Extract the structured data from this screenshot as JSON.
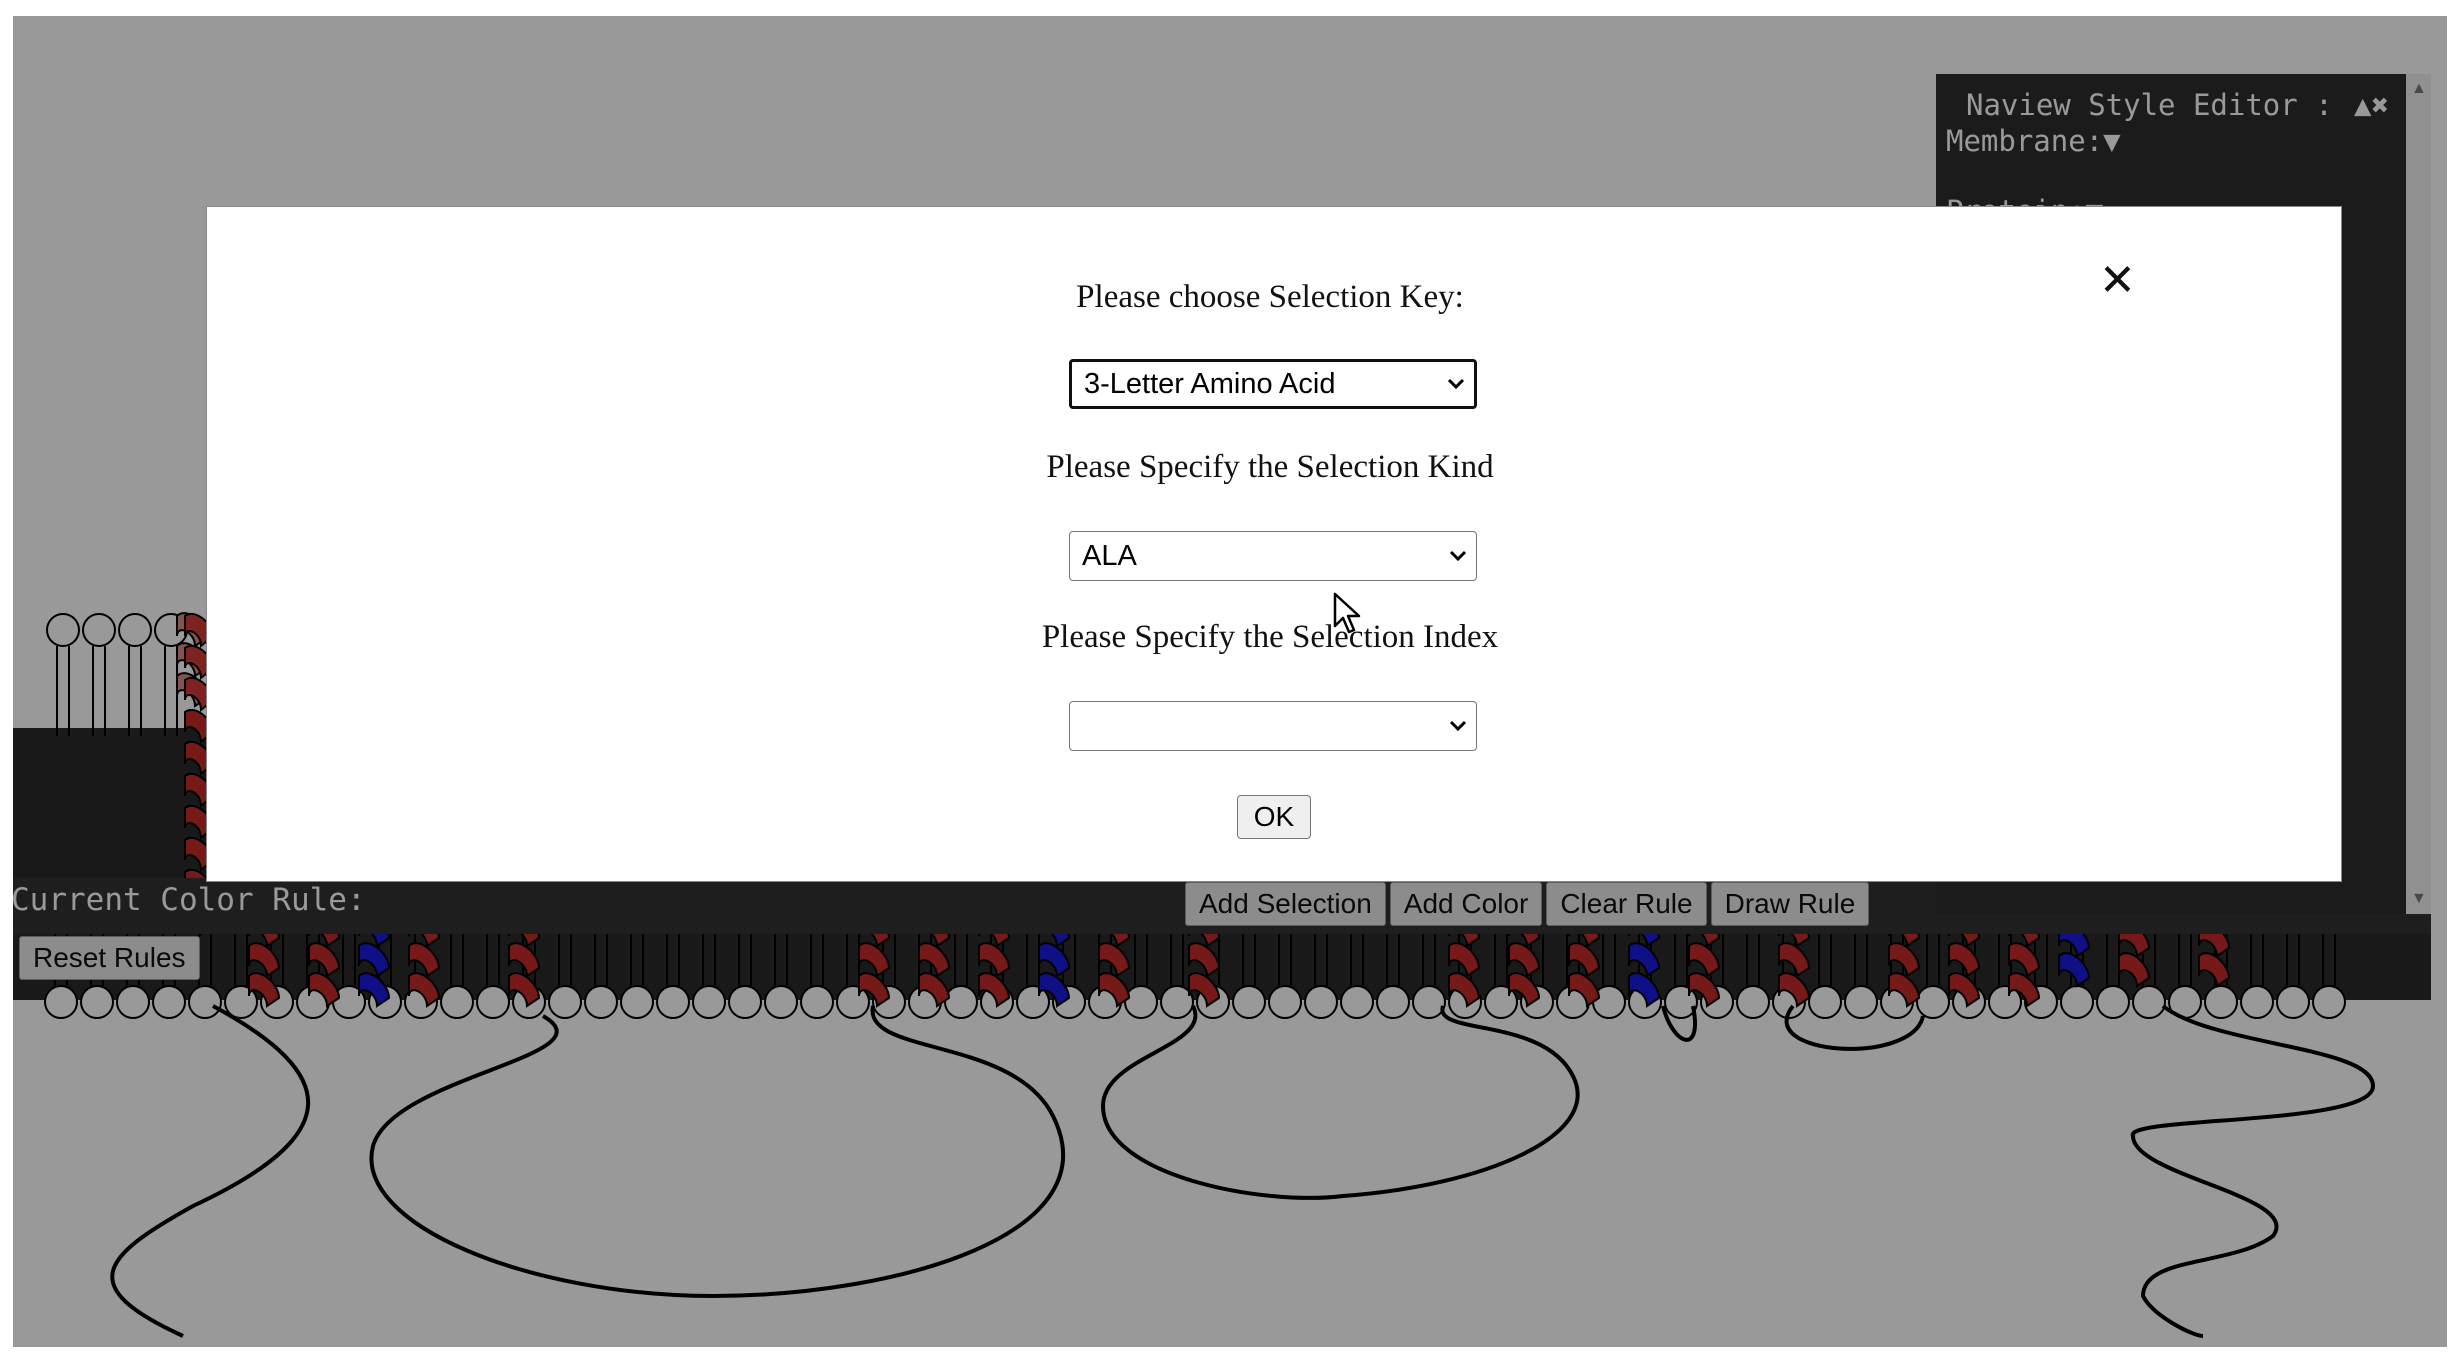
{
  "dialog": {
    "key_prompt": "Please choose Selection Key:",
    "key_value": "3-Letter Amino Acid",
    "kind_prompt": "Please Specify the Selection Kind",
    "kind_value": "ALA",
    "index_prompt": "Please Specify the Selection Index",
    "index_value": "",
    "ok_label": "OK",
    "close_glyph": "✕"
  },
  "toolbar": {
    "current_rule_label": "Current Color Rule:",
    "buttons": [
      "Add Selection",
      "Add Color",
      "Clear Rule",
      "Draw Rule"
    ],
    "reset_label": "Reset Rules"
  },
  "style_editor": {
    "title": "Naview Style Editor :",
    "controls": "▲✖",
    "sections": [
      "Membrane:▼",
      "Protein:▼"
    ]
  },
  "colors": {
    "overlay": "rgba(0,0,0,0.40)",
    "helix_red": "#d33a3a",
    "helix_pink": "#e08a80",
    "helix_blue": "#1a1ae0",
    "editor_bg": "#2e2e2e"
  },
  "icons": [
    "close-icon",
    "chevron-down-icon",
    "mouse-pointer-icon",
    "collapse-icon"
  ]
}
